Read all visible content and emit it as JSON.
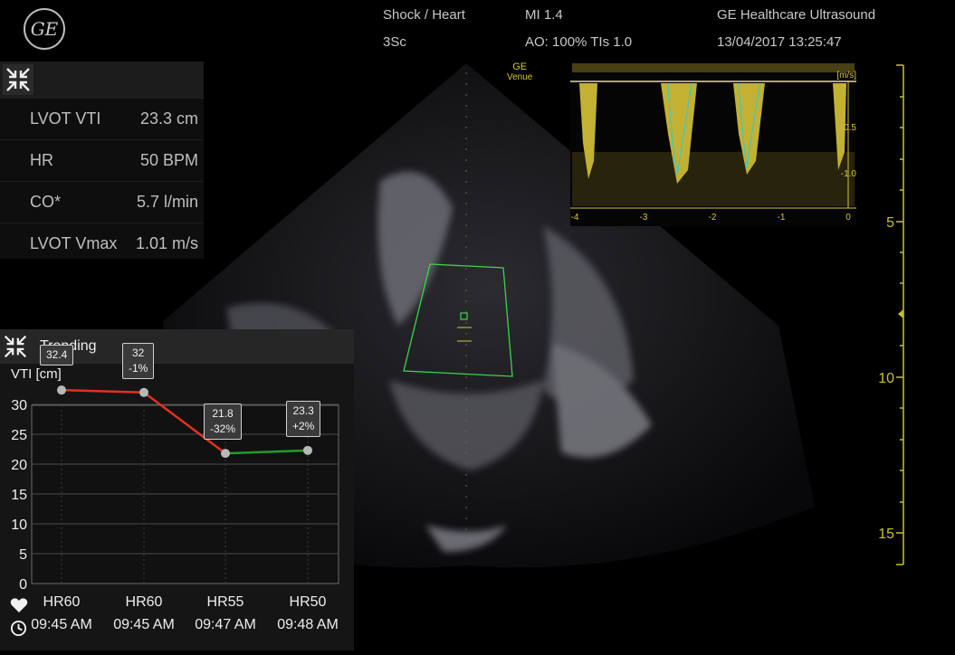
{
  "header": {
    "logo_text": "GE",
    "preset": "Shock / Heart",
    "probe": "3Sc",
    "mi": "MI 1.4",
    "ao_tis": "AO: 100% TIs 1.0",
    "vendor": "GE Healthcare Ultrasound",
    "datetime": "13/04/2017 13:25:47"
  },
  "venue_tag": {
    "line1": "GE",
    "line2": "Venue"
  },
  "measurements": {
    "icon": "collapse-arrows-icon",
    "rows": [
      {
        "label": "LVOT VTI",
        "value": "23.3 cm"
      },
      {
        "label": "HR",
        "value": "50 BPM"
      },
      {
        "label": "CO*",
        "value": "5.7 l/min"
      },
      {
        "label": "LVOT Vmax",
        "value": "1.01 m/s"
      }
    ]
  },
  "doppler": {
    "unit": "[m/s]",
    "y_ticks": [
      "-0.5",
      "-1.0"
    ],
    "x_ticks": [
      "-4",
      "-3",
      "-2",
      "-1",
      "0"
    ],
    "trace_color": "#d8c43a",
    "baseline_color": "#e8d9a0"
  },
  "depth_ruler": {
    "ticks": [
      "5",
      "10",
      "15"
    ],
    "color": "#c9c21e"
  },
  "roi_color": "#38d64a",
  "trending": {
    "title": "Trending",
    "ylabel": "VTI [cm]",
    "icon": "collapse-arrows-icon",
    "chart_data": {
      "type": "line",
      "ylabel": "VTI [cm]",
      "ylim": [
        0,
        30
      ],
      "y_ticks": [
        0,
        5,
        10,
        15,
        20,
        25,
        30
      ],
      "grid": true,
      "categories": [
        "HR60 09:45 AM",
        "HR60 09:45 AM",
        "HR55 09:47 AM",
        "HR50 09:48 AM"
      ],
      "points": [
        {
          "hr": "HR60",
          "time": "09:45 AM",
          "value": 32.4,
          "label_value": "32.4",
          "label_change": ""
        },
        {
          "hr": "HR60",
          "time": "09:45 AM",
          "value": 32,
          "label_value": "32",
          "label_change": "-1%"
        },
        {
          "hr": "HR55",
          "time": "09:47 AM",
          "value": 21.8,
          "label_value": "21.8",
          "label_change": "-32%"
        },
        {
          "hr": "HR50",
          "time": "09:48 AM",
          "value": 22.3,
          "label_value": "23.3",
          "label_change": "+2%"
        }
      ],
      "segment_colors": [
        "#e0321e",
        "#e0321e",
        "#1e9e2a"
      ],
      "marker_color": "#b8b8b8"
    }
  }
}
